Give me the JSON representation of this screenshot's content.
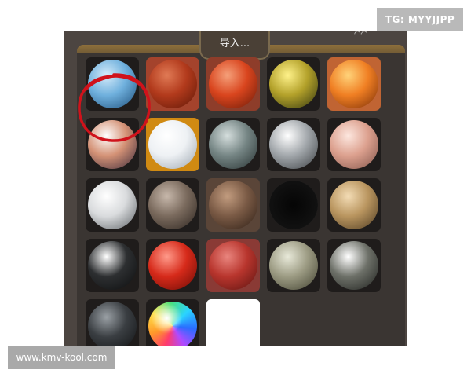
{
  "watermarks": {
    "tg": "TG: MYYJJPP",
    "url": "www.kmv-kool.com"
  },
  "panel": {
    "import_label": "导入...",
    "corner_glyph": "◠◠"
  },
  "colors": {
    "annotation": "#d0121b",
    "selection": "#d08a12",
    "panel_bg": "#4c4541"
  },
  "materials": [
    {
      "name": "sky-blue",
      "bg": "#1f1c1b",
      "hl": "#d6ecfa",
      "mid": "#6fb0dd",
      "dk": "#1d4e7a"
    },
    {
      "name": "brick-red",
      "bg": "#a4432c",
      "hl": "#e07a55",
      "mid": "#b23a1c",
      "dk": "#5e1707"
    },
    {
      "name": "orange-red",
      "bg": "#8e3d2a",
      "hl": "#f5a07a",
      "mid": "#d9451e",
      "dk": "#6a1a08"
    },
    {
      "name": "yellow-green",
      "bg": "#1f1c1b",
      "hl": "#fff28a",
      "mid": "#b3a12a",
      "dk": "#2f3410"
    },
    {
      "name": "orange",
      "bg": "#c06433",
      "hl": "#ffd37a",
      "mid": "#f07f23",
      "dk": "#7a2e08"
    },
    {
      "name": "skin-dark",
      "bg": "#1f1c1b",
      "hl": "#ffffff",
      "mid": "#d49276",
      "dk": "#3b2a3a"
    },
    {
      "name": "white-selected",
      "bg": "#d08a12",
      "hl": "#ffffff",
      "mid": "#eef1f4",
      "dk": "#9aa4ae"
    },
    {
      "name": "grey-teal",
      "bg": "#1f1c1b",
      "hl": "#d5dedd",
      "mid": "#758584",
      "dk": "#263030"
    },
    {
      "name": "silver-grey",
      "bg": "#1f1c1b",
      "hl": "#ffffff",
      "mid": "#a2a7ab",
      "dk": "#3a3e41"
    },
    {
      "name": "skin-pink",
      "bg": "#1f1c1b",
      "hl": "#fde7df",
      "mid": "#dca08e",
      "dk": "#80544a"
    },
    {
      "name": "white",
      "bg": "#1f1c1b",
      "hl": "#ffffff",
      "mid": "#d9dbdd",
      "dk": "#5b6064"
    },
    {
      "name": "taupe",
      "bg": "#1f1c1b",
      "hl": "#c7b8ab",
      "mid": "#7a6a5d",
      "dk": "#2c241f"
    },
    {
      "name": "brown",
      "bg": "#5a4538",
      "hl": "#c29c7f",
      "mid": "#7a5a45",
      "dk": "#2e1f16"
    },
    {
      "name": "black-rim",
      "bg": "#1f1c1b",
      "hl": "#3a3a3a",
      "mid": "#121212",
      "dk": "#000000"
    },
    {
      "name": "tan",
      "bg": "#1f1c1b",
      "hl": "#f3dcb5",
      "mid": "#b9955f",
      "dk": "#4d3a21"
    },
    {
      "name": "black-gloss",
      "bg": "#1f1c1b",
      "hl": "#ffffff",
      "mid": "#2d2f31",
      "dk": "#0c0d0e"
    },
    {
      "name": "red-gloss",
      "bg": "#1f1c1b",
      "hl": "#ff9a8a",
      "mid": "#d62a1a",
      "dk": "#6a0b05"
    },
    {
      "name": "crimson",
      "bg": "#8a3a35",
      "hl": "#e9857e",
      "mid": "#b8352d",
      "dk": "#5c1310"
    },
    {
      "name": "khaki-grey",
      "bg": "#1f1c1b",
      "hl": "#e8e9d9",
      "mid": "#9c9b83",
      "dk": "#40402f"
    },
    {
      "name": "grey-gloss",
      "bg": "#1f1c1b",
      "hl": "#ffffff",
      "mid": "#6d7068",
      "dk": "#1e201d"
    },
    {
      "name": "charcoal",
      "bg": "#1f1c1b",
      "hl": "#9aa0a5",
      "mid": "#3a3e42",
      "dk": "#101214"
    },
    {
      "name": "rainbow",
      "bg": "#1f1c1b",
      "hl": "#ffffff",
      "mid": "#8a5cff",
      "dk": "#2a6cff"
    },
    {
      "name": "white-flat",
      "bg": "#ffffff",
      "hl": "#ffffff",
      "mid": "#ffffff",
      "dk": "#ffffff"
    }
  ]
}
